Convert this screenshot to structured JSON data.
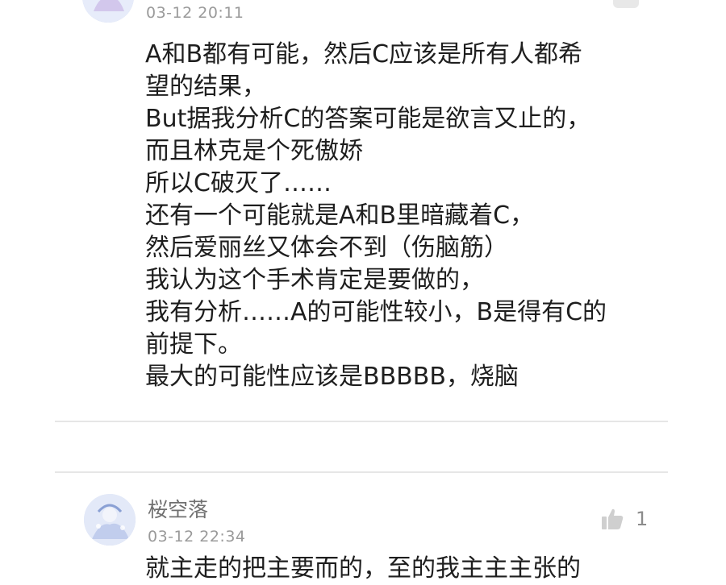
{
  "comments": [
    {
      "timestamp": "03-12 20:11",
      "body_lines": [
        "A和B都有可能，然后C应该是所有人都希",
        "望的结果，",
        "But据我分析C的答案可能是欲言又止的，",
        "而且林克是个死傲娇",
        "所以C破灭了……",
        "还有一个可能就是A和B里暗藏着C，",
        "然后爱丽丝又体会不到（伤脑筋）",
        "我认为这个手术肯定是要做的，",
        "我有分析……A的可能性较小，B是得有C的",
        "前提下。",
        "最大的可能性应该是BBBBB，烧脑"
      ]
    },
    {
      "username": "桜空落",
      "timestamp": "03-12 22:34",
      "likes": "1",
      "body_partial": "就主走的把主要而的，至的我主主主张的"
    }
  ],
  "icons": {
    "like": "thumbs-up-icon",
    "avatar": "avatar-image"
  },
  "colors": {
    "text": "#1e1e1e",
    "muted": "#9a9a9a",
    "divider": "#e6e6e6",
    "icon": "#c8c8c8"
  }
}
